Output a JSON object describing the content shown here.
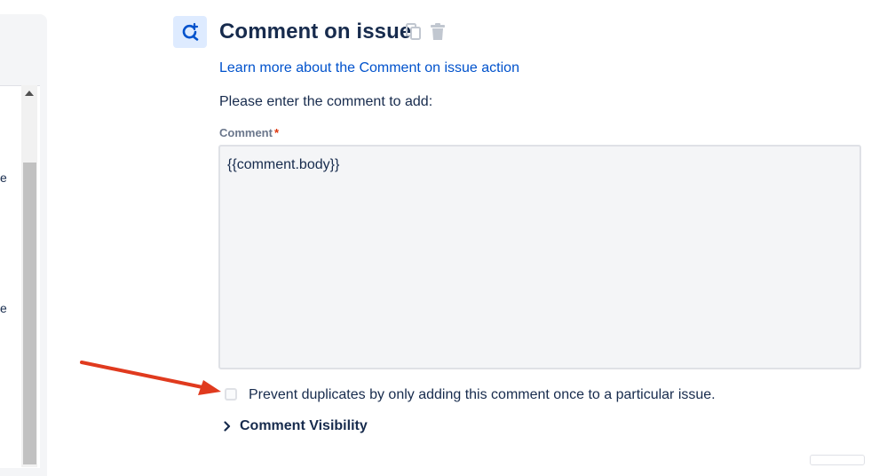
{
  "sidebar": {
    "fragments": [
      "e",
      "e"
    ]
  },
  "action": {
    "title": "Comment on issue",
    "learn_more": "Learn more about the Comment on issue action",
    "instructions": "Please enter the comment to add:",
    "comment_label": "Comment",
    "required_marker": "*",
    "comment_value": "{{comment.body}}",
    "prevent_duplicates_label": "Prevent duplicates by only adding this comment once to a particular issue.",
    "visibility_label": "Comment Visibility"
  },
  "colors": {
    "link": "#0052cc",
    "annotation_arrow": "#e03a1e",
    "icon_bg": "#deebff"
  },
  "icons": {
    "action": "comment-refresh-icon",
    "copy": "copy-icon",
    "delete": "trash-icon",
    "expand": "chevron-right-icon"
  }
}
